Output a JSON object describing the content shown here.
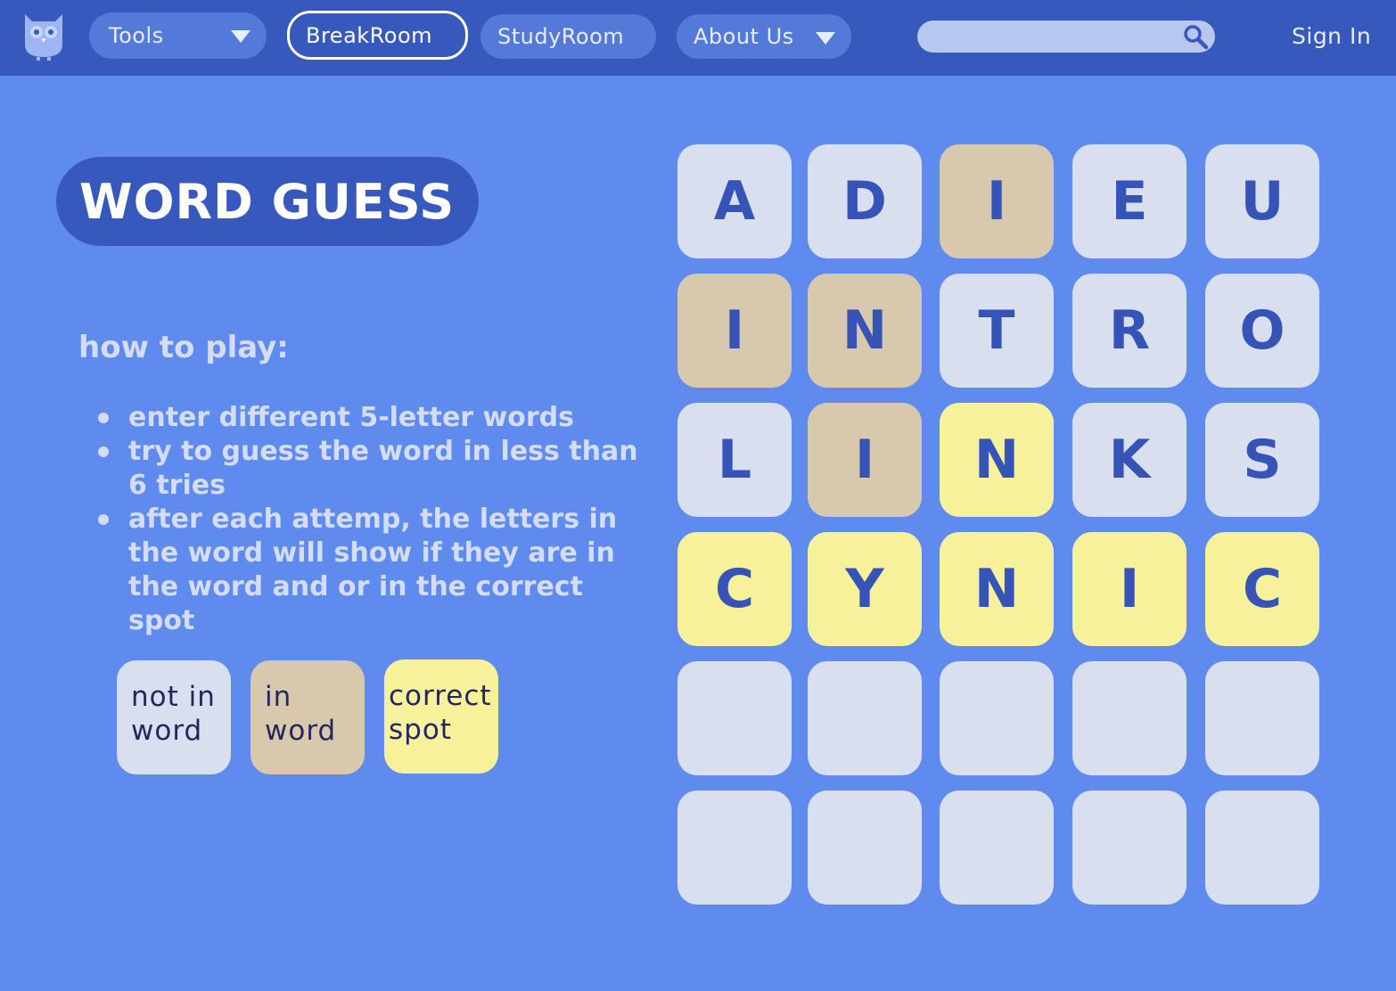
{
  "nav": {
    "tools_label": "Tools",
    "breakroom_label": "BreakRoom",
    "studyroom_label": "StudyRoom",
    "about_label": "About Us",
    "search_placeholder": "",
    "signin_label": "Sign In"
  },
  "game": {
    "title": "WORD GUESS",
    "howto_title": "how to play:",
    "rules": [
      "enter different 5-letter words",
      "try to guess the word in less than 6 tries",
      "after each attemp, the letters in the word will show if they are in the word and or in the correct spot"
    ],
    "legend": {
      "absent": "not in word",
      "present": "in word",
      "correct": "correct spot"
    },
    "board": [
      [
        {
          "letter": "A",
          "state": "absent"
        },
        {
          "letter": "D",
          "state": "absent"
        },
        {
          "letter": "I",
          "state": "present"
        },
        {
          "letter": "E",
          "state": "absent"
        },
        {
          "letter": "U",
          "state": "absent"
        }
      ],
      [
        {
          "letter": "I",
          "state": "present"
        },
        {
          "letter": "N",
          "state": "present"
        },
        {
          "letter": "T",
          "state": "absent"
        },
        {
          "letter": "R",
          "state": "absent"
        },
        {
          "letter": "O",
          "state": "absent"
        }
      ],
      [
        {
          "letter": "L",
          "state": "absent"
        },
        {
          "letter": "I",
          "state": "present"
        },
        {
          "letter": "N",
          "state": "correct"
        },
        {
          "letter": "K",
          "state": "absent"
        },
        {
          "letter": "S",
          "state": "absent"
        }
      ],
      [
        {
          "letter": "C",
          "state": "correct"
        },
        {
          "letter": "Y",
          "state": "correct"
        },
        {
          "letter": "N",
          "state": "correct"
        },
        {
          "letter": "I",
          "state": "correct"
        },
        {
          "letter": "C",
          "state": "correct"
        }
      ],
      [
        {
          "letter": "",
          "state": "empty"
        },
        {
          "letter": "",
          "state": "empty"
        },
        {
          "letter": "",
          "state": "empty"
        },
        {
          "letter": "",
          "state": "empty"
        },
        {
          "letter": "",
          "state": "empty"
        }
      ],
      [
        {
          "letter": "",
          "state": "empty"
        },
        {
          "letter": "",
          "state": "empty"
        },
        {
          "letter": "",
          "state": "empty"
        },
        {
          "letter": "",
          "state": "empty"
        },
        {
          "letter": "",
          "state": "empty"
        }
      ]
    ]
  },
  "colors": {
    "background": "#5f8bef",
    "navbar": "#3759be",
    "absent": "#d8dfee",
    "present": "#d8c9ae",
    "correct": "#f8f19c",
    "letter": "#3653b7"
  }
}
